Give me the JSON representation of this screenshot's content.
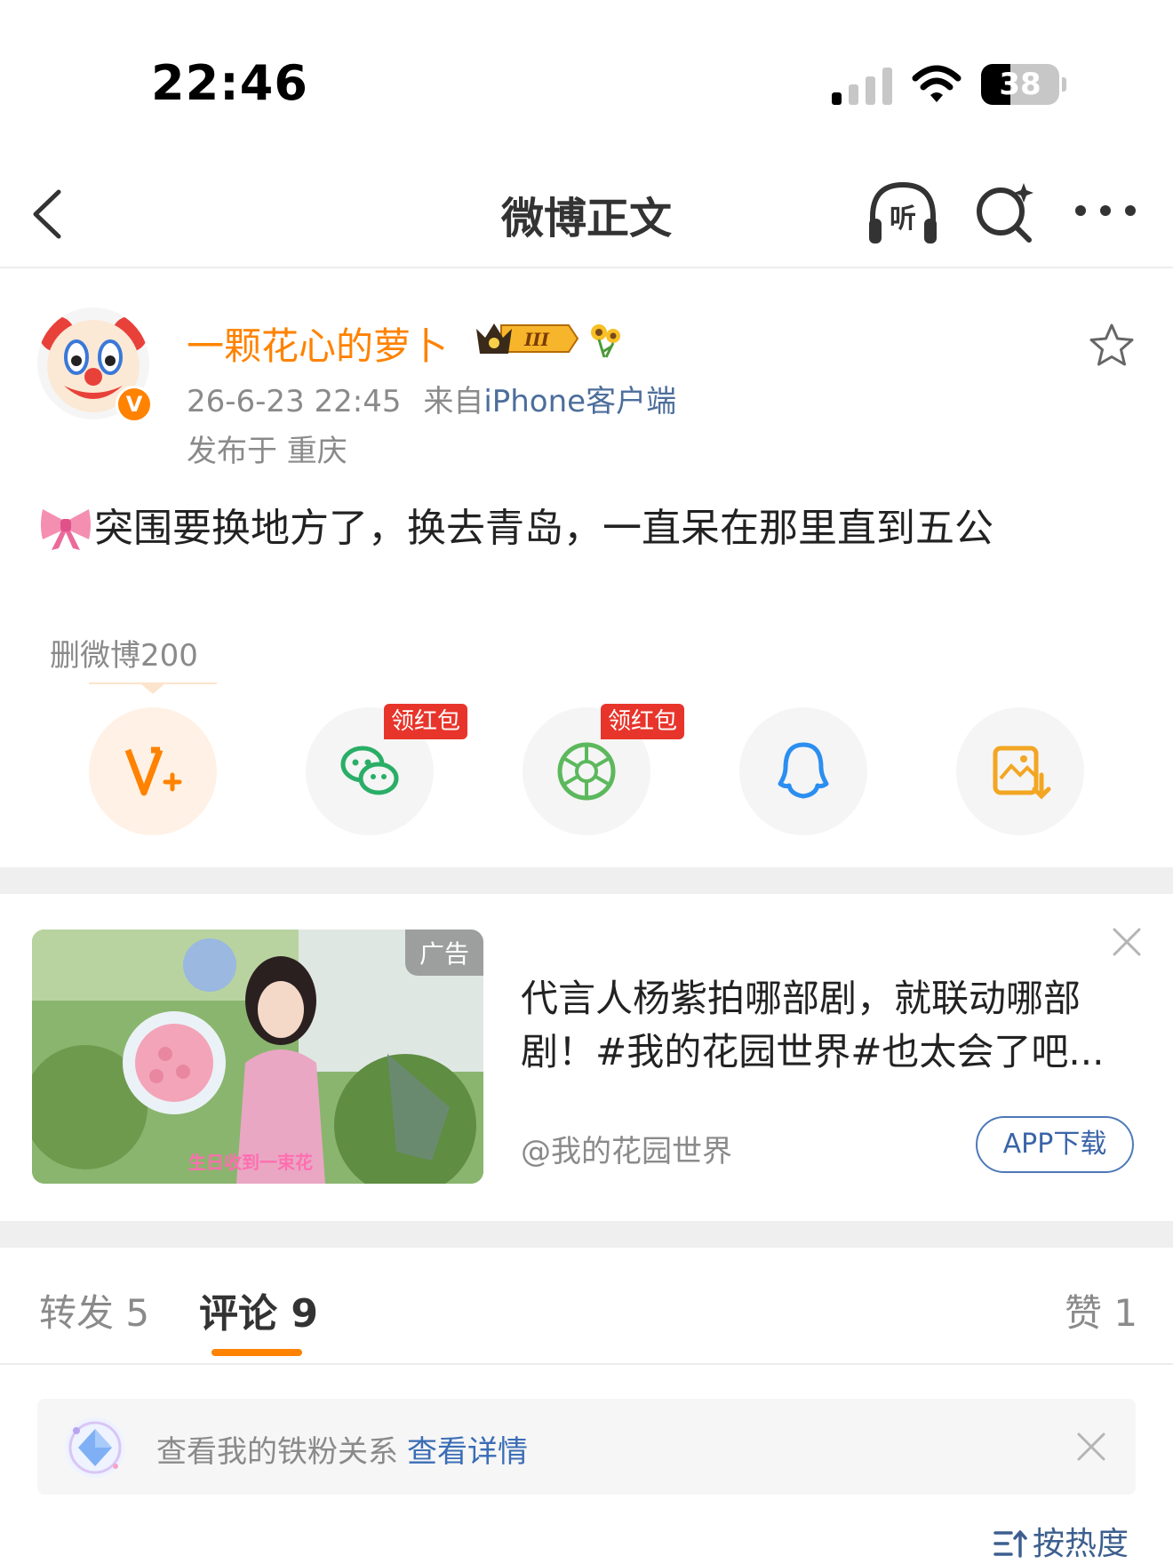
{
  "status_bar": {
    "time": "22:46",
    "battery": "38",
    "battery_level": 0.38
  },
  "navbar": {
    "title": "微博正文"
  },
  "post": {
    "username": "一颗花心的萝卜",
    "timestamp": "26-6-23 22:45",
    "from_prefix": "来自",
    "source": "iPhone客户端",
    "location": "发布于 重庆",
    "text": "突围要换地方了，换去青岛，一直呆在那里直到五公"
  },
  "share": {
    "label": "删微博200",
    "red_packet_label": "领红包"
  },
  "ad": {
    "tag": "广告",
    "image_caption": "生日收到一束花",
    "title": "代言人杨紫拍哪部剧，就联动哪部剧！#我的花园世界#也太会了吧...",
    "account": "@我的花园世界",
    "button": "APP下载"
  },
  "tabs": {
    "repost": "转发 5",
    "comment": "评论 9",
    "like": "赞 1"
  },
  "fan_banner": {
    "text": "查看我的铁粉关系",
    "link": "查看详情"
  },
  "sort": {
    "label": "按热度"
  },
  "colors": {
    "accent": "#ff8200",
    "link": "#3a6db5",
    "red_packet": "#e8352b"
  }
}
